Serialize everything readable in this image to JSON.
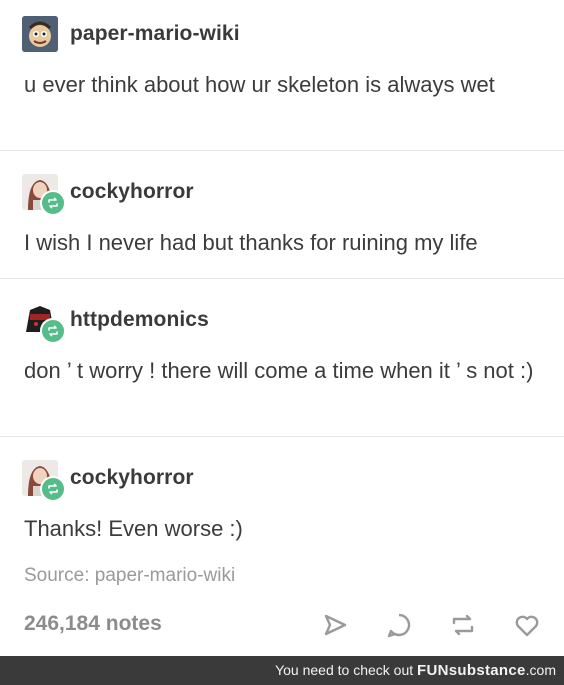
{
  "posts": [
    {
      "username": "paper-mario-wiki",
      "avatar": "cartoon-character-avatar",
      "text": "u ever think about how ur skeleton is always wet"
    },
    {
      "username": "cockyhorror",
      "avatar": "person-avatar",
      "reblog_icon": "reblog-icon",
      "text": "I wish I never had but thanks for ruining my life"
    },
    {
      "username": "httpdemonics",
      "avatar": "dark-character-avatar",
      "reblog_icon": "reblog-icon",
      "text": "don ’ t worry ! there will come a time when it ’ s not :)"
    },
    {
      "username": "cockyhorror",
      "avatar": "person-avatar",
      "reblog_icon": "reblog-icon",
      "text": "Thanks! Even worse :)"
    }
  ],
  "source": "Source: paper-mario-wiki",
  "footer": {
    "notes": "246,184 notes",
    "actions": [
      "share-icon",
      "reply-icon",
      "reblog-icon",
      "like-icon"
    ]
  },
  "watermark": {
    "prefix": "You need to check out",
    "brand": "FUNsubstance",
    "suffix": ".com"
  },
  "colors": {
    "reblog_badge": "#56bc8a",
    "watermark_bg": "#3a3a3a"
  }
}
